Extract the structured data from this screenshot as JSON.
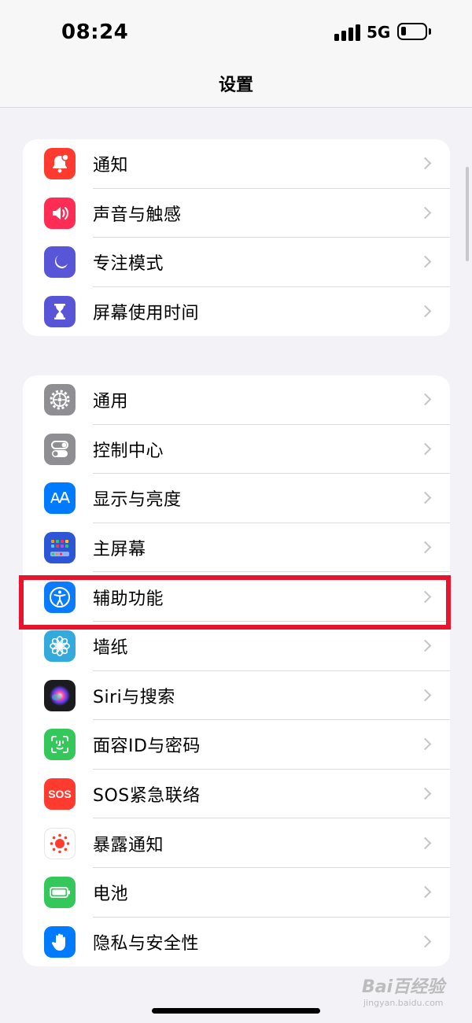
{
  "status_bar": {
    "time": "08:24",
    "network": "5G"
  },
  "nav": {
    "title": "设置"
  },
  "group1": [
    {
      "label": "通知",
      "icon": "notifications-icon",
      "color": "#ff3b30"
    },
    {
      "label": "声音与触感",
      "icon": "sound-icon",
      "color": "#ff2d55"
    },
    {
      "label": "专注模式",
      "icon": "moon-icon",
      "color": "#5856d6"
    },
    {
      "label": "屏幕使用时间",
      "icon": "hourglass-icon",
      "color": "#5856d6"
    }
  ],
  "group2": [
    {
      "label": "通用",
      "icon": "gear-icon",
      "color": "#8e8e93"
    },
    {
      "label": "控制中心",
      "icon": "toggles-icon",
      "color": "#8e8e93"
    },
    {
      "label": "显示与亮度",
      "icon": "text-size-icon",
      "color": "#007aff"
    },
    {
      "label": "主屏幕",
      "icon": "home-screen-icon",
      "color": "#2c56d6"
    },
    {
      "label": "辅助功能",
      "icon": "accessibility-icon",
      "color": "#0a7aff"
    },
    {
      "label": "墙纸",
      "icon": "flower-icon",
      "color": "#34aadc"
    },
    {
      "label": "Siri与搜索",
      "icon": "siri-icon",
      "color": "#1c1c1e"
    },
    {
      "label": "面容ID与密码",
      "icon": "face-id-icon",
      "color": "#34c759"
    },
    {
      "label": "SOS紧急联络",
      "icon": "sos-icon",
      "color": "#ff3b30",
      "badge": "SOS"
    },
    {
      "label": "暴露通知",
      "icon": "exposure-icon",
      "color": "#ffffff"
    },
    {
      "label": "电池",
      "icon": "battery-icon",
      "color": "#34c759"
    },
    {
      "label": "隐私与安全性",
      "icon": "hand-icon",
      "color": "#007aff"
    }
  ],
  "highlight_color": "#e8132c",
  "watermark": {
    "main": "Bai百经验",
    "sub": "jingyan.baidu.com"
  }
}
